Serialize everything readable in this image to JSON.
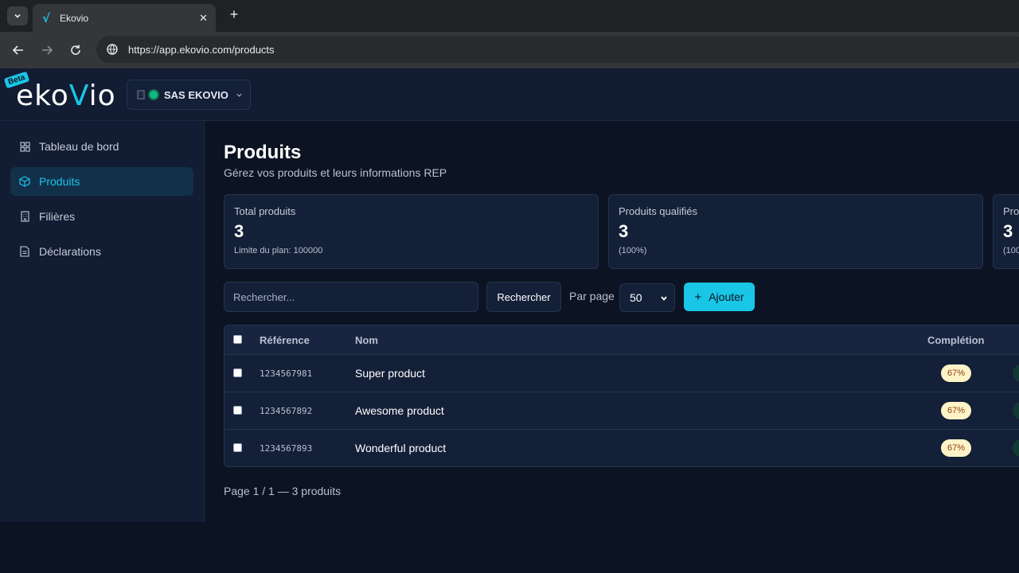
{
  "browser": {
    "tab_title": "Ekovio",
    "tab_favicon": "√",
    "close_glyph": "✕",
    "newtab_glyph": "+",
    "url": "https://app.ekovio.com/products"
  },
  "header": {
    "logo_pre": "eko",
    "logo_v": "V",
    "logo_post": "io",
    "beta": "Beta",
    "org_name": "SAS EKOVIO",
    "org_status_color": "#10b981"
  },
  "sidebar": {
    "items": [
      {
        "label": "Tableau de bord",
        "icon": "grid-icon",
        "active": false
      },
      {
        "label": "Produits",
        "icon": "box-icon",
        "active": true
      },
      {
        "label": "Filières",
        "icon": "building-icon",
        "active": false
      },
      {
        "label": "Déclarations",
        "icon": "file-icon",
        "active": false
      }
    ]
  },
  "main": {
    "title": "Produits",
    "subtitle": "Gérez vos produits et leurs informations REP",
    "stats": [
      {
        "label": "Total produits",
        "value": "3",
        "note": "Limite du plan: 100000"
      },
      {
        "label": "Produits qualifiés",
        "value": "3",
        "note": "(100%)"
      },
      {
        "label": "Pro",
        "value": "3",
        "note": "(100"
      }
    ],
    "search_placeholder": "Rechercher...",
    "search_button": "Rechercher",
    "per_page_label": "Par page",
    "per_page_value": "50",
    "add_button": "Ajouter",
    "add_plus": "+",
    "table": {
      "headers": {
        "ref": "Référence",
        "name": "Nom",
        "completion": "Complétion"
      },
      "rows": [
        {
          "ref": "1234567981",
          "name": "Super product",
          "completion": "67%"
        },
        {
          "ref": "1234567892",
          "name": "Awesome product",
          "completion": "67%"
        },
        {
          "ref": "1234567893",
          "name": "Wonderful product",
          "completion": "67%"
        }
      ]
    },
    "pagination": "Page 1 / 1 — 3 produits"
  },
  "colors": {
    "accent": "#19c6e6",
    "background": "#0c1322",
    "panel": "#141f38",
    "badge_bg": "#fef3c7",
    "badge_fg": "#92400e"
  }
}
